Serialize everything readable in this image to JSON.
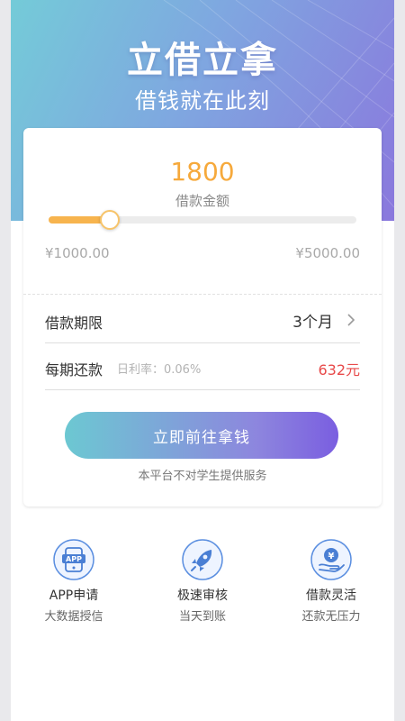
{
  "hero": {
    "title": "立借立拿",
    "subtitle": "借钱就在此刻"
  },
  "loan": {
    "amount": "1800",
    "amount_label": "借款金额",
    "slider_level": 0.2,
    "min_label": "¥1000.00",
    "max_label": "¥5000.00"
  },
  "term": {
    "label": "借款期限",
    "value": "3个月"
  },
  "repayment": {
    "label": "每期还款",
    "rate": "日利率：0.06%",
    "value": "632元"
  },
  "cta": {
    "label": "立即前往拿钱",
    "notice": "本平台不对学生提供服务"
  },
  "features": [
    {
      "icon": "app-icon",
      "title": "APP申请",
      "subtitle": "大数据授信",
      "badge": "APP"
    },
    {
      "icon": "rocket-icon",
      "title": "极速审核",
      "subtitle": "当天到账"
    },
    {
      "icon": "yuan-hand-icon",
      "title": "借款灵活",
      "subtitle": "还款无压力",
      "badge": "¥"
    }
  ],
  "colors": {
    "accent_amount": "#f6a93b",
    "repay_value": "#e84a4a",
    "cta_start": "#6cc8d2",
    "cta_end": "#7a5ee0",
    "icon_blue": "#4a7fd4"
  }
}
